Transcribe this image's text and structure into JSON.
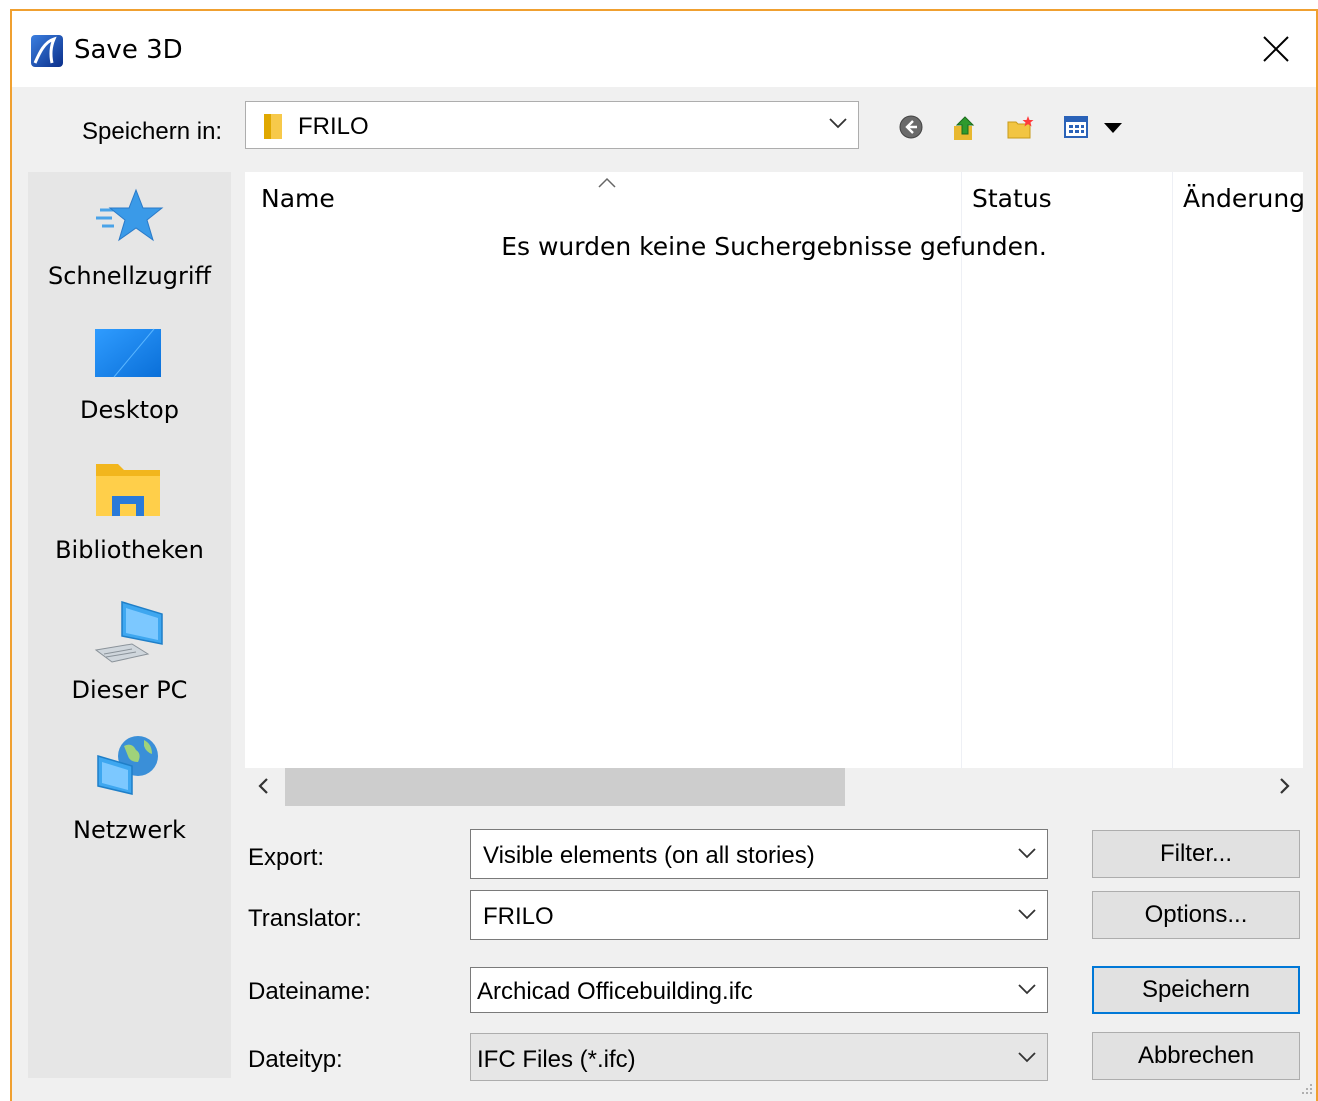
{
  "window": {
    "title": "Save 3D"
  },
  "lookin": {
    "label": "Speichern in:",
    "value": "FRILO"
  },
  "toolbar": {
    "back_icon": "back-arrow-icon",
    "up_icon": "up-folder-icon",
    "new_folder_icon": "new-folder-icon",
    "view_menu_icon": "view-menu-icon"
  },
  "places": [
    {
      "label": "Schnellzugriff",
      "icon": "star-icon"
    },
    {
      "label": "Desktop",
      "icon": "desktop-icon"
    },
    {
      "label": "Bibliotheken",
      "icon": "libraries-icon"
    },
    {
      "label": "Dieser PC",
      "icon": "computer-icon"
    },
    {
      "label": "Netzwerk",
      "icon": "network-icon"
    }
  ],
  "filelist": {
    "columns": [
      "Name",
      "Status",
      "Änderung"
    ],
    "empty_message": "Es wurden keine Suchergebnisse gefunden."
  },
  "form": {
    "export": {
      "label": "Export:",
      "value": "Visible elements (on all stories)"
    },
    "translator": {
      "label": "Translator:",
      "value": "FRILO"
    },
    "filename": {
      "label": "Dateiname:",
      "value": "Archicad Officebuilding.ifc"
    },
    "filetype": {
      "label": "Dateityp:",
      "value": "IFC Files (*.ifc)"
    }
  },
  "buttons": {
    "filter": "Filter...",
    "options": "Options...",
    "save": "Speichern",
    "cancel": "Abbrechen"
  },
  "colors": {
    "accent": "#0078d7",
    "window_border": "#f0a030"
  }
}
